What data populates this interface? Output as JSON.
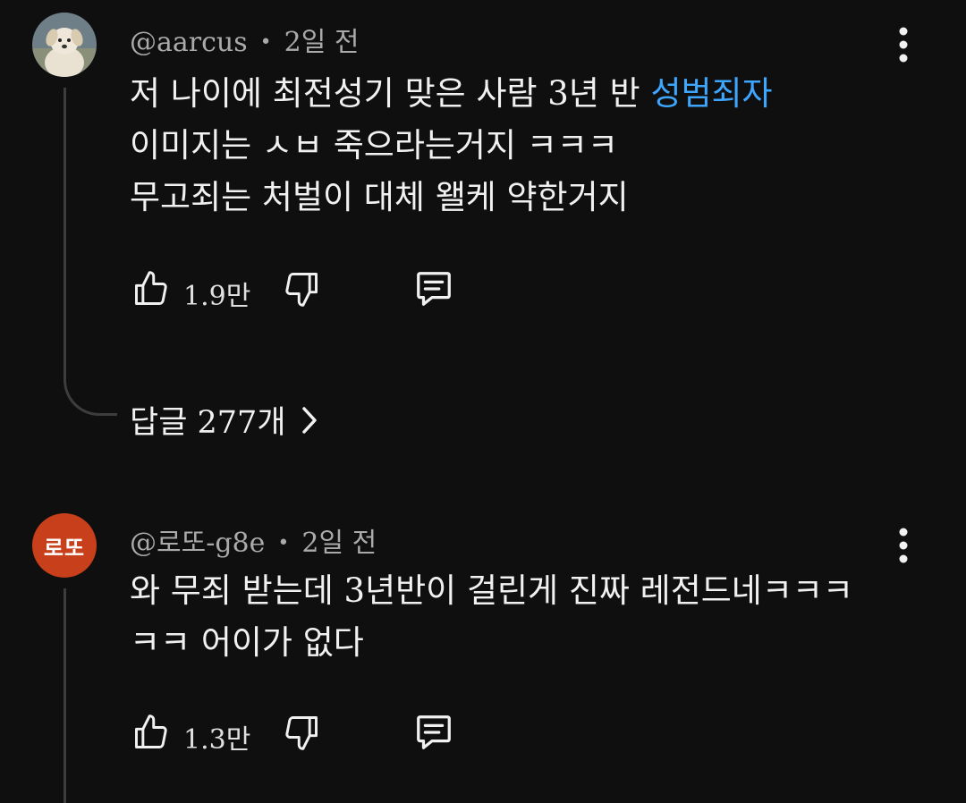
{
  "comments": [
    {
      "author": "@aarcus",
      "time": "2일 전",
      "line1_prefix": "저 나이에 최전성기 맞은 사람 3년 반 ",
      "line1_link": "성범죄자",
      "line2": "이미지는 ㅅㅂ 죽으라는거지  ㅋㅋㅋ",
      "line3": "무고죄는 처벌이 대체 왤케 약한거지",
      "likes": "1.9만",
      "replies_label": "답글 277개",
      "avatar_icon": "puppy-avatar"
    },
    {
      "author": "@로또-g8e",
      "time": "2일 전",
      "avatar_text": "로또",
      "line1": "와 무죄 받는데 3년반이 걸린게 진짜 레전드네ㅋㅋㅋ",
      "line2": "ㅋㅋ 어이가 없다",
      "likes": "1.3만"
    }
  ],
  "icons": {
    "like": "thumbs-up-icon",
    "dislike": "thumbs-down-icon",
    "reply": "comment-icon",
    "more": "vertical-dots-icon",
    "chevron": "chevron-right-icon"
  },
  "colors": {
    "background": "#0f0f0f",
    "link": "#3ea6ff",
    "avatar_bg": "#c8401b"
  }
}
